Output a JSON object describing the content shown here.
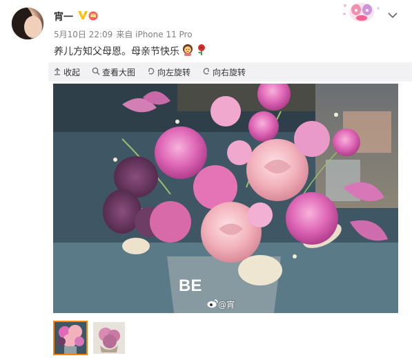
{
  "post": {
    "username": "宵一",
    "time": "5月10日 22:09",
    "source": "来自 iPhone 11 Pro",
    "text": "养儿方知父母恩。母亲节快乐"
  },
  "toolbar": {
    "collapse_label": "收起",
    "view_large_label": "查看大图",
    "rotate_left_label": "向左旋转",
    "rotate_right_label": "向右旋转"
  },
  "image": {
    "watermark": "@宵",
    "vase_text": "BE"
  },
  "thumbnails": [
    {
      "name": "thumbnail-1",
      "active": true
    },
    {
      "name": "thumbnail-2",
      "active": false
    }
  ],
  "colors": {
    "accent": "#ff8200",
    "vip_gold": "#ffc107",
    "toolbar_bg": "#f2f2f5",
    "meta_gray": "#808080"
  },
  "icons": [
    "vip-badge-icon",
    "crown-icon",
    "chevron-down-icon",
    "collapse-icon",
    "magnifier-icon",
    "rotate-left-icon",
    "rotate-right-icon",
    "weibo-logo-icon",
    "woman-emoji-icon",
    "rose-emoji-icon"
  ]
}
